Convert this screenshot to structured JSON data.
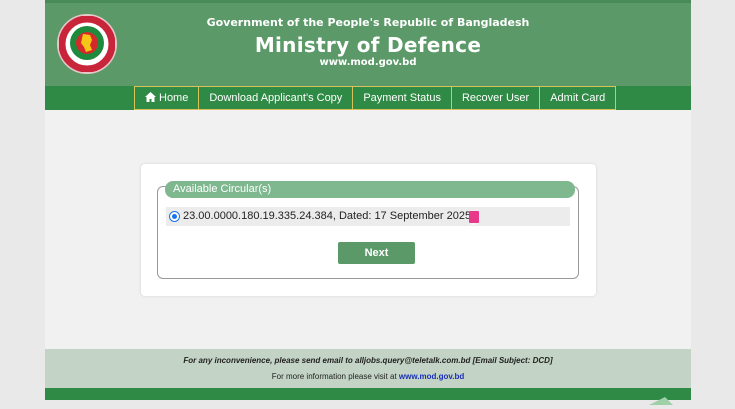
{
  "header": {
    "gov_line": "Government of the People's Republic of Bangladesh",
    "ministry": "Ministry of Defence",
    "site": "www.mod.gov.bd",
    "emblem_icon": "bangladesh-emblem"
  },
  "nav": {
    "items": [
      {
        "label": "Home",
        "icon": "home-icon"
      },
      {
        "label": "Download Applicant's Copy"
      },
      {
        "label": "Payment Status"
      },
      {
        "label": "Recover User"
      },
      {
        "label": "Admit Card"
      }
    ]
  },
  "circular": {
    "legend": "Available Circular(s)",
    "item_text": "23.00.0000.180.19.335.24.384, Dated: 17 September 2025",
    "selected": true,
    "next_label": "Next"
  },
  "footer": {
    "line1": "For any inconvenience, please send email to alljobs.query@teletalk.com.bd [Email Subject: DCD]",
    "line2_prefix": "For more information please visit at",
    "line2_link": "www.mod.gov.bd"
  },
  "colors": {
    "header_green": "#5b9a68",
    "nav_green": "#2f8a45",
    "legend_green": "#7fb88f",
    "pdf_pink": "#e8388a"
  }
}
